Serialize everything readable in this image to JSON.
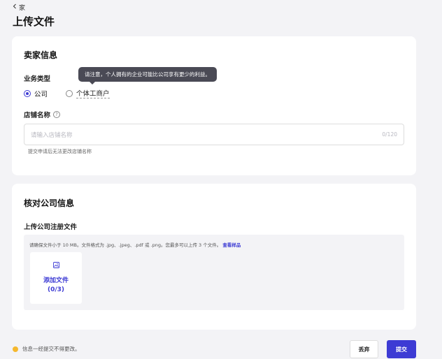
{
  "header": {
    "back_label": "家",
    "title": "上传文件"
  },
  "seller_card": {
    "title": "卖家信息",
    "business_type": {
      "label": "业务类型",
      "options": [
        {
          "label": "公司",
          "checked": true
        },
        {
          "label": "个体工商户",
          "checked": false
        }
      ],
      "tooltip": "请注意，个人拥有的企业可能比公司享有更少的利益。"
    },
    "store_name": {
      "label": "店铺名称",
      "help_icon_glyph": "?",
      "placeholder": "请输入店铺名称",
      "counter": "0/120",
      "hint": "提交申请后无法更改店铺名称"
    }
  },
  "company_card": {
    "title": "核对公司信息",
    "upload": {
      "label": "上传公司注册文件",
      "note": "请确保文件小于 10 MB。文件格式为 .jpg、.jpeg、.pdf 或 .png。您最多可以上传 3 个文件。",
      "sample_link": "查看样品",
      "add_label": "添加文件",
      "add_count": "(0/3)"
    }
  },
  "footer": {
    "note": "信息一经提交不得更改。",
    "discard_label": "丢弃",
    "submit_label": "提交"
  },
  "colors": {
    "accent": "#3d3bd4",
    "warning": "#f5b82e",
    "tooltip_bg": "#4a4a55"
  },
  "icons": {
    "back": "chevron-left-icon",
    "help": "question-circle-icon",
    "image": "image-icon",
    "warning": "warning-dot-icon"
  }
}
